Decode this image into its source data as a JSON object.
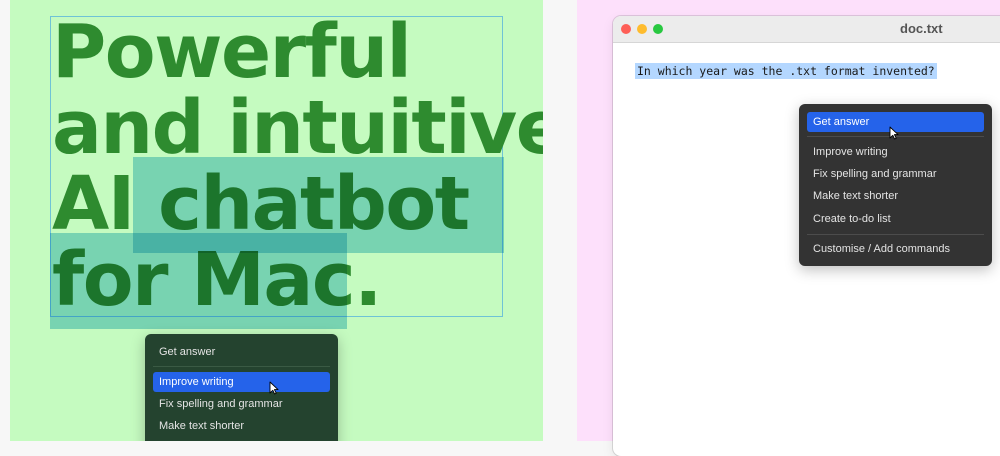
{
  "headline": {
    "line1": "Powerful",
    "line2": "and intuitive",
    "line3_prefix": "AI ",
    "line3_word": "chatbot",
    "line4": "for Mac."
  },
  "menu_left": {
    "items": [
      "Get answer",
      "Improve writing",
      "Fix spelling and grammar",
      "Make text shorter"
    ],
    "active": "Improve writing"
  },
  "window": {
    "title": "doc.txt",
    "selected_text": "In which year was the .txt format invented?"
  },
  "menu_right": {
    "items": [
      "Get answer",
      "Improve writing",
      "Fix spelling and grammar",
      "Make text shorter",
      "Create to-do list",
      "Customise / Add commands"
    ],
    "active": "Get answer"
  },
  "colors": {
    "left_bg": "#c5fbc0",
    "headline": "#2e8b2f",
    "selection": "#48b6dc",
    "right_bg": "#fde0fb",
    "menu_active": "#2563ea"
  }
}
